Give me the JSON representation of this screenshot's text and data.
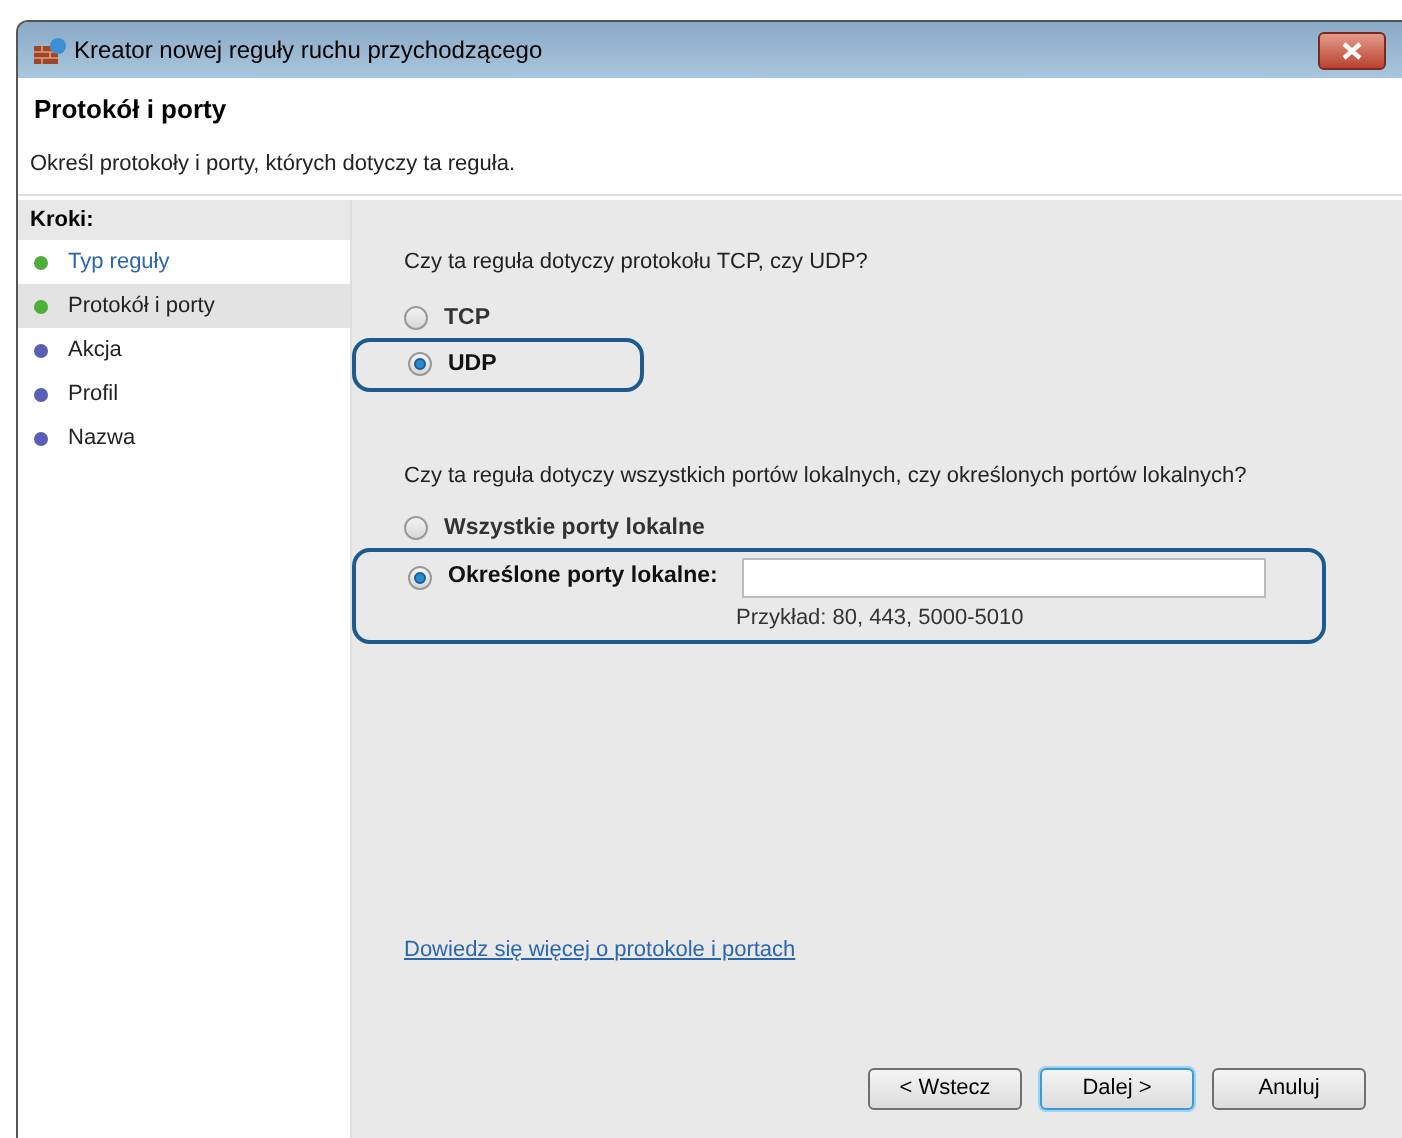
{
  "window": {
    "title": "Kreator nowej reguły ruchu przychodzącego"
  },
  "header": {
    "title": "Protokół i porty",
    "subtitle": "Określ protokoły i porty, których dotyczy ta reguła."
  },
  "sidebar": {
    "title": "Kroki:",
    "items": [
      {
        "label": "Typ reguły",
        "selected": false,
        "done": true
      },
      {
        "label": "Protokół i porty",
        "selected": true,
        "done": true
      },
      {
        "label": "Akcja",
        "selected": false,
        "done": false
      },
      {
        "label": "Profil",
        "selected": false,
        "done": false
      },
      {
        "label": "Nazwa",
        "selected": false,
        "done": false
      }
    ]
  },
  "protocol": {
    "question": "Czy ta reguła dotyczy protokołu TCP, czy UDP?",
    "options": [
      {
        "label": "TCP",
        "selected": false,
        "highlighted": false
      },
      {
        "label": "UDP",
        "selected": true,
        "highlighted": true
      }
    ]
  },
  "ports": {
    "question": "Czy ta reguła dotyczy wszystkich portów lokalnych, czy określonych portów lokalnych?",
    "options": [
      {
        "label": "Wszystkie porty lokalne",
        "selected": false,
        "highlighted": false
      },
      {
        "label": "Określone porty lokalne:",
        "selected": true,
        "highlighted": true,
        "field": true
      }
    ],
    "example": "Przykład: 80, 443, 5000-5010"
  },
  "link": "Dowiedz się więcej o protokole i portach",
  "buttons": [
    {
      "label": "< Wstecz",
      "default": false
    },
    {
      "label": "Dalej >",
      "default": true
    },
    {
      "label": "Anuluj",
      "default": false
    }
  ]
}
